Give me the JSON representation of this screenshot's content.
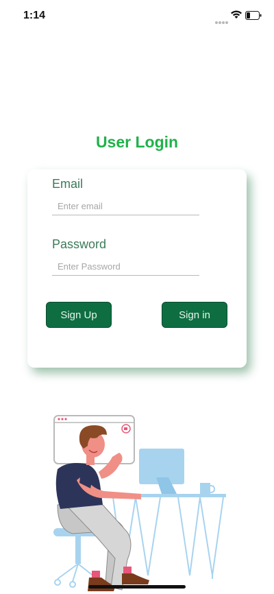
{
  "status_bar": {
    "time": "1:14",
    "icons": [
      "cellular-dots-icon",
      "wifi-icon",
      "battery-icon"
    ]
  },
  "title": "User Login",
  "form": {
    "email_label": "Email",
    "email_placeholder": "Enter email",
    "email_value": "",
    "password_label": "Password",
    "password_placeholder": "Enter Password",
    "password_value": "",
    "signup_label": "Sign Up",
    "signin_label": "Sign in"
  },
  "colors": {
    "title": "#1fb24a",
    "button_bg": "#0e6e42",
    "label": "#3b7a58",
    "card_shadow": "#2d7a4a"
  },
  "illustration": {
    "name": "person-at-computer-desk-illustration"
  }
}
